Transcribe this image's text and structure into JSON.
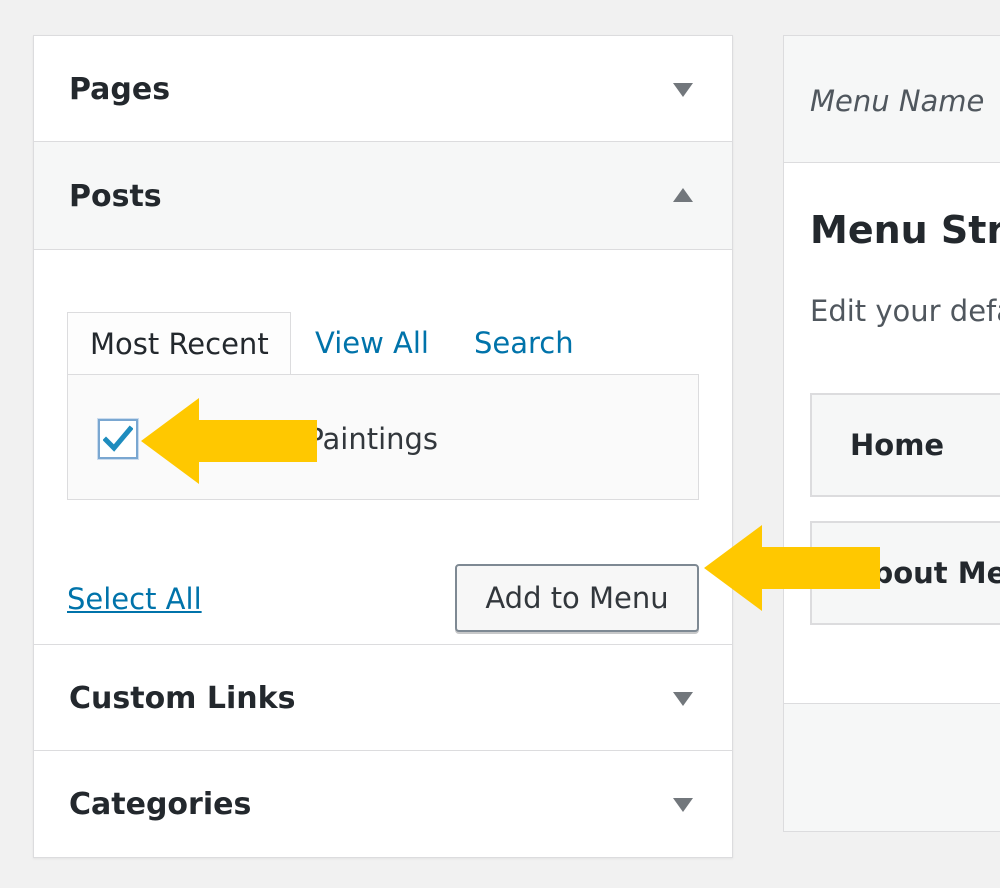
{
  "left_panel": {
    "sections": {
      "pages": {
        "title": "Pages",
        "state": "collapsed"
      },
      "posts": {
        "title": "Posts",
        "state": "expanded"
      },
      "custom_links": {
        "title": "Custom Links",
        "state": "collapsed"
      },
      "categories": {
        "title": "Categories",
        "state": "collapsed"
      }
    },
    "posts_tabs": {
      "most_recent": "Most Recent",
      "view_all": "View All",
      "search": "Search",
      "active": "Most Recent"
    },
    "posts_items": [
      {
        "label": "Seascape Paintings",
        "checked": true
      }
    ],
    "select_all_label": "Select All",
    "add_to_menu_label": "Add to Menu"
  },
  "right_panel": {
    "menu_name_label": "Menu Name",
    "menu_structure_title": "Menu Stru",
    "menu_description": "Edit your defa",
    "menu_items": [
      {
        "label": "Home"
      },
      {
        "label": "About Me"
      }
    ]
  },
  "colors": {
    "link": "#0073aa",
    "annotation_arrow": "#ffc800",
    "checkbox_check": "#1e8cbe",
    "page_background": "#f1f1f1"
  },
  "icons": {
    "collapse_arrow": "triangle-up-icon",
    "expand_arrow": "triangle-down-icon",
    "checkmark": "checkmark-icon",
    "annotation": "yellow-pointer-arrow"
  }
}
